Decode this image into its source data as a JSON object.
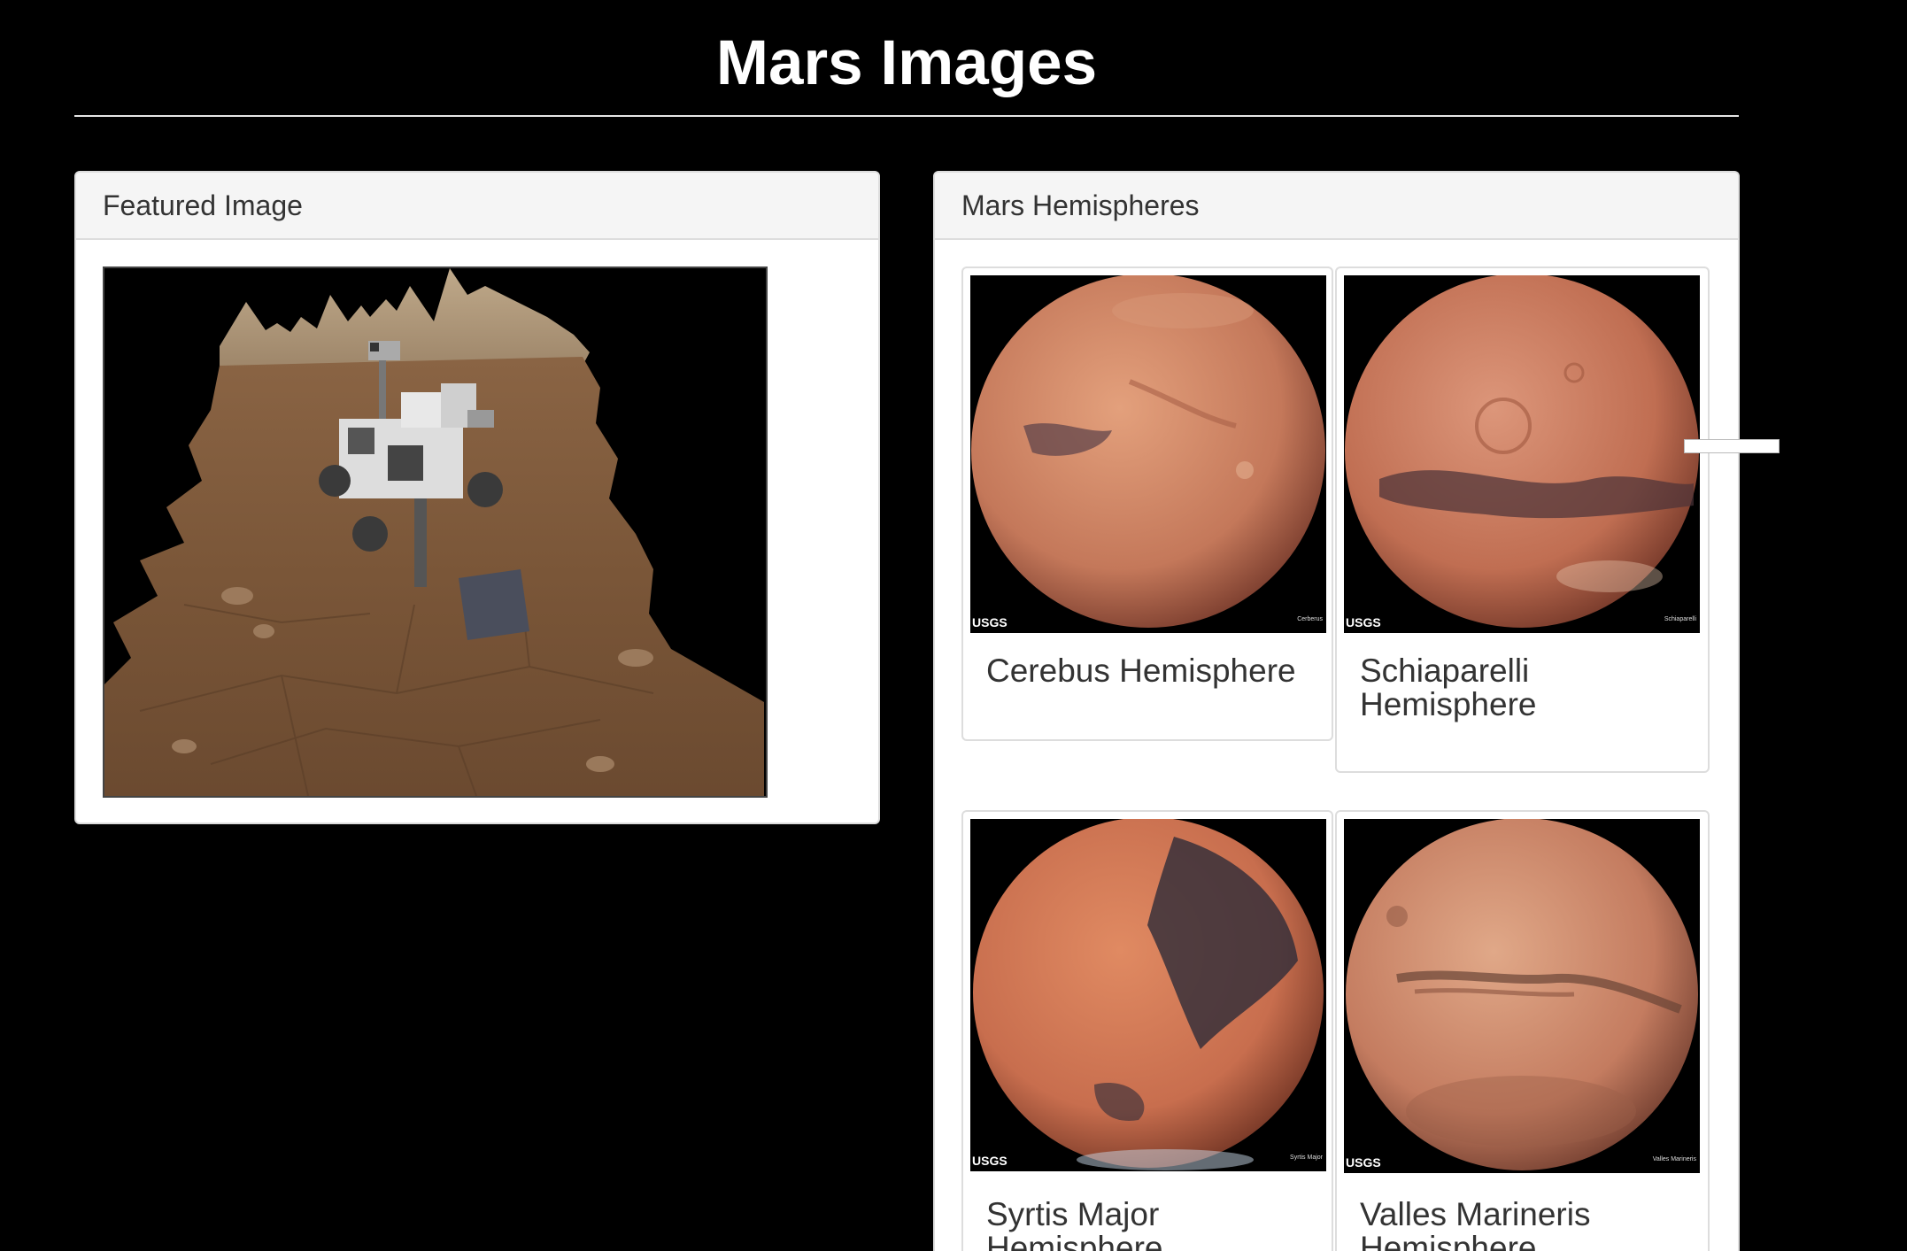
{
  "page": {
    "title": "Mars Images"
  },
  "featured": {
    "heading": "Featured Image"
  },
  "hemispheres": {
    "heading": "Mars Hemispheres",
    "items": [
      {
        "title": "Cerebus Hemisphere",
        "usgs": "USGS",
        "label": "Cerberus",
        "colors": {
          "base": "#c4785a",
          "dark": "#5a4048",
          "light": "#e3a07c"
        }
      },
      {
        "title": "Schiaparelli Hemisphere",
        "usgs": "USGS",
        "label": "Schiaparelli",
        "colors": {
          "base": "#c06e52",
          "dark": "#4a3238",
          "light": "#dc967a"
        }
      },
      {
        "title": "Syrtis Major Hemisphere",
        "usgs": "USGS",
        "label": "Syrtis Major",
        "colors": {
          "base": "#c86e4e",
          "dark": "#2e2c38",
          "light": "#e08a62"
        }
      },
      {
        "title": "Valles Marineris Hemisphere",
        "usgs": "USGS",
        "label": "Valles Marineris",
        "colors": {
          "base": "#c47c60",
          "dark": "#6a4436",
          "light": "#e0a888"
        }
      }
    ]
  }
}
